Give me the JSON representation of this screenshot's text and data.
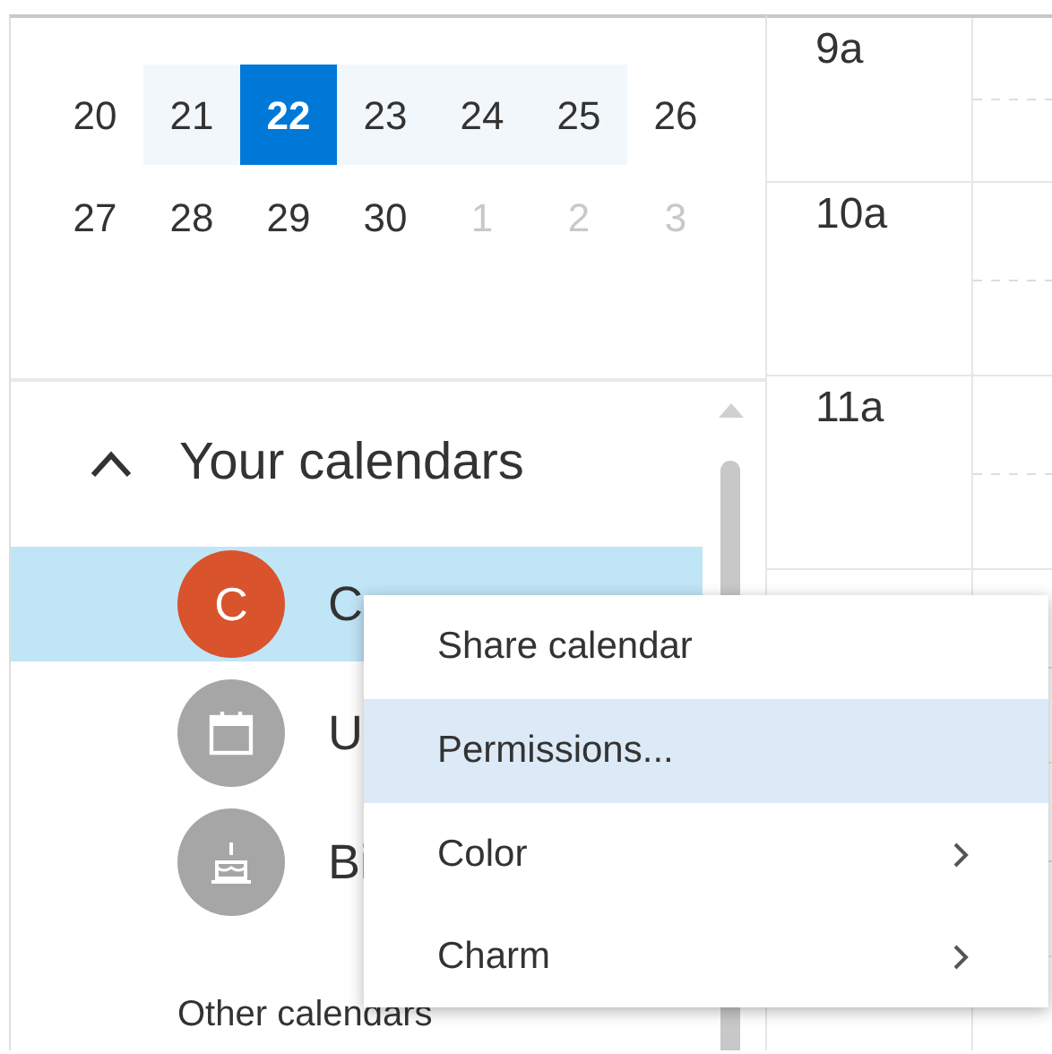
{
  "mini_calendar": {
    "weeks": [
      {
        "days": [
          {
            "label": "20",
            "selected": false,
            "in_week": false,
            "other_month": false
          },
          {
            "label": "21",
            "selected": false,
            "in_week": true,
            "other_month": false
          },
          {
            "label": "22",
            "selected": true,
            "in_week": true,
            "other_month": false
          },
          {
            "label": "23",
            "selected": false,
            "in_week": true,
            "other_month": false
          },
          {
            "label": "24",
            "selected": false,
            "in_week": true,
            "other_month": false
          },
          {
            "label": "25",
            "selected": false,
            "in_week": true,
            "other_month": false
          },
          {
            "label": "26",
            "selected": false,
            "in_week": false,
            "other_month": false
          }
        ]
      },
      {
        "days": [
          {
            "label": "27",
            "selected": false,
            "in_week": false,
            "other_month": false
          },
          {
            "label": "28",
            "selected": false,
            "in_week": false,
            "other_month": false
          },
          {
            "label": "29",
            "selected": false,
            "in_week": false,
            "other_month": false
          },
          {
            "label": "30",
            "selected": false,
            "in_week": false,
            "other_month": false
          },
          {
            "label": "1",
            "selected": false,
            "in_week": false,
            "other_month": true
          },
          {
            "label": "2",
            "selected": false,
            "in_week": false,
            "other_month": true
          },
          {
            "label": "3",
            "selected": false,
            "in_week": false,
            "other_month": true
          }
        ]
      }
    ]
  },
  "your_calendars": {
    "title": "Your calendars",
    "expanded": true,
    "items": [
      {
        "name": "C",
        "kind": "initial",
        "initial": "C",
        "color": "#d9532c",
        "selected": true
      },
      {
        "name": "U",
        "kind": "calendar",
        "color": "#a6a6a6",
        "selected": false
      },
      {
        "name": "Bi",
        "kind": "birthday",
        "color": "#a6a6a6",
        "selected": false
      }
    ]
  },
  "other_calendars": {
    "title": "Other calendars"
  },
  "time_labels": [
    "9a",
    "10a",
    "11a"
  ],
  "context_menu": {
    "items": [
      {
        "label": "Share calendar",
        "selected": false,
        "submenu": false
      },
      {
        "label": "Permissions...",
        "selected": true,
        "submenu": false
      },
      {
        "label": "Color",
        "selected": false,
        "submenu": true
      },
      {
        "label": "Charm",
        "selected": false,
        "submenu": true
      }
    ]
  }
}
